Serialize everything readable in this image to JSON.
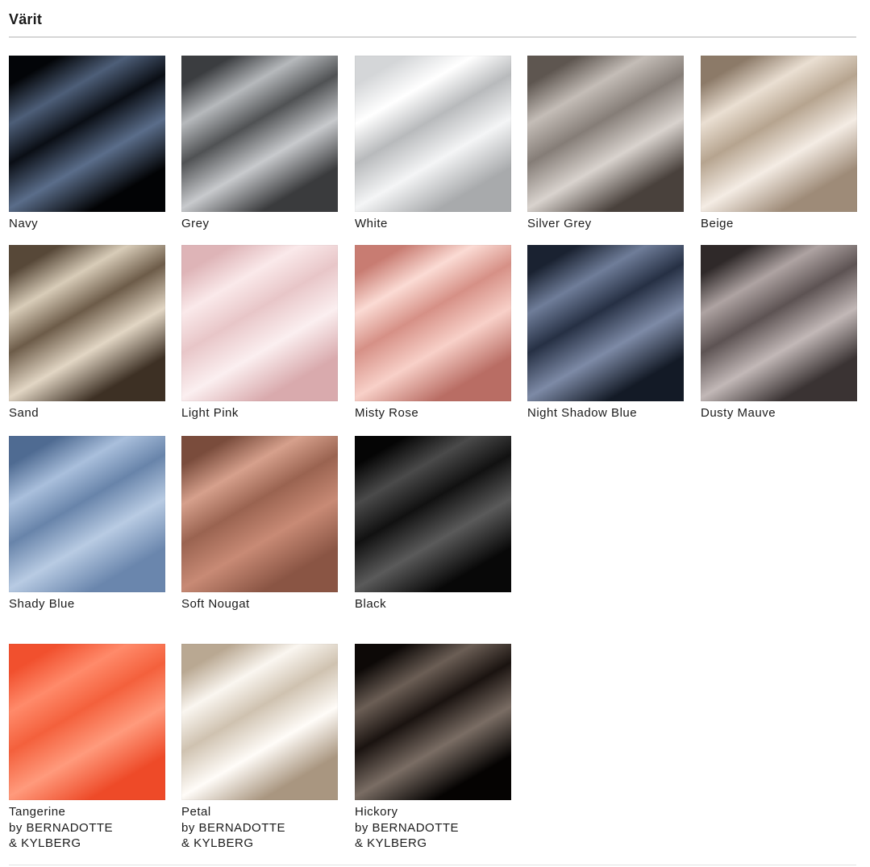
{
  "section": {
    "title": "Värit"
  },
  "swatches": [
    {
      "label": [
        "Navy"
      ],
      "colors": [
        "#030508",
        "#4d5e78",
        "#0a0e15",
        "#5a6d8a",
        "#020305"
      ]
    },
    {
      "label": [
        "Grey"
      ],
      "colors": [
        "#3b3d40",
        "#b6b9bc",
        "#505254",
        "#c8cacd",
        "#3a3b3d"
      ]
    },
    {
      "label": [
        "White"
      ],
      "colors": [
        "#d4d6d8",
        "#ffffff",
        "#b8babc",
        "#f4f5f6",
        "#a8aaac"
      ]
    },
    {
      "label": [
        "Silver Grey"
      ],
      "colors": [
        "#5e5650",
        "#c4bdb7",
        "#857d77",
        "#d9d3ce",
        "#49413c"
      ]
    },
    {
      "label": [
        "Beige"
      ],
      "colors": [
        "#8c7a68",
        "#eadfd2",
        "#b6a48f",
        "#f4ece4",
        "#9e8b78"
      ]
    },
    {
      "label": [
        "Sand"
      ],
      "colors": [
        "#574838",
        "#d8ccb8",
        "#6d5c49",
        "#e2d6c4",
        "#3d3024"
      ]
    },
    {
      "label": [
        "Light Pink"
      ],
      "colors": [
        "#deb4b7",
        "#fae9ea",
        "#e8c6c8",
        "#fbeff0",
        "#d9aaad"
      ]
    },
    {
      "label": [
        "Misty Rose"
      ],
      "colors": [
        "#c87c72",
        "#fbdbd4",
        "#d69086",
        "#f8d0c8",
        "#b96d64"
      ]
    },
    {
      "label": [
        "Night Shadow Blue"
      ],
      "colors": [
        "#1a2231",
        "#6f7d99",
        "#263044",
        "#7d8aa6",
        "#131a26"
      ]
    },
    {
      "label": [
        "Dusty Mauve"
      ],
      "colors": [
        "#2f2929",
        "#aea3a2",
        "#5d5353",
        "#c2b8b7",
        "#3a3333"
      ]
    },
    {
      "label": [
        "Shady Blue"
      ],
      "colors": [
        "#4f6b92",
        "#a9bfdc",
        "#6884aa",
        "#b8cbe3",
        "#6a86ad"
      ]
    },
    {
      "label": [
        "Soft Nougat"
      ],
      "colors": [
        "#7a4c3c",
        "#d6a08c",
        "#9a6350",
        "#c88a75",
        "#8a5544"
      ]
    },
    {
      "label": [
        "Black"
      ],
      "colors": [
        "#050505",
        "#4a4a4a",
        "#111111",
        "#5a5a5a",
        "#080808"
      ]
    },
    {
      "label": [
        "Tangerine",
        "by BERNADOTTE",
        "& KYLBERG"
      ],
      "colors": [
        "#f1502e",
        "#ff8a6a",
        "#f4603c",
        "#ff9a7c",
        "#ee4a28"
      ]
    },
    {
      "label": [
        "Petal",
        "by BERNADOTTE",
        "& KYLBERG"
      ],
      "colors": [
        "#b9a892",
        "#faf6f0",
        "#cfc2b0",
        "#fffcf8",
        "#a99680"
      ]
    },
    {
      "label": [
        "Hickory",
        "by BERNADOTTE",
        "& KYLBERG"
      ],
      "colors": [
        "#0d0907",
        "#6b5e55",
        "#1a1310",
        "#7a6d64",
        "#050302"
      ]
    }
  ]
}
